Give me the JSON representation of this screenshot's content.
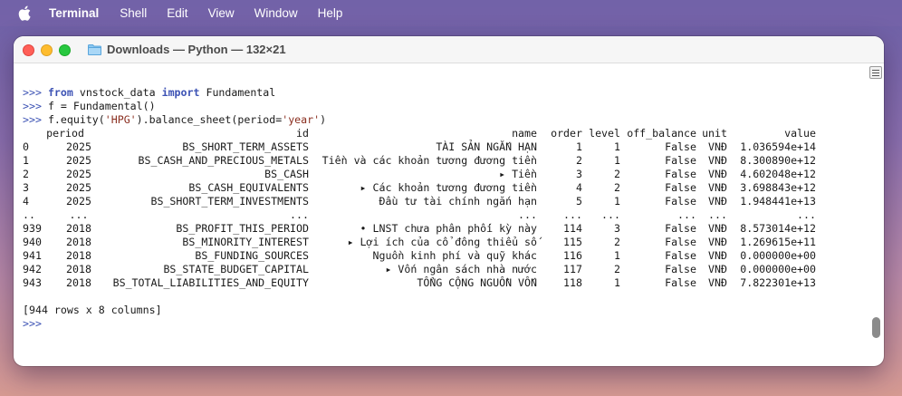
{
  "menubar": {
    "app_name": "Terminal",
    "items": [
      "Shell",
      "Edit",
      "View",
      "Window",
      "Help"
    ]
  },
  "window": {
    "title": "Downloads — Python — 132×21"
  },
  "terminal": {
    "prompt": ">>>",
    "line1": {
      "kw_from": "from",
      "module": " vnstock_data ",
      "kw_import": "import",
      "name": " Fundamental"
    },
    "line2": "f = Fundamental()",
    "line3": {
      "pre": "f.equity(",
      "arg1": "'HPG'",
      "mid": ").balance_sheet(period=",
      "arg2": "'year'",
      "post": ")"
    },
    "columns": [
      "period",
      "id",
      "name",
      "order",
      "level",
      "off_balance",
      "unit",
      "value"
    ],
    "rows": [
      [
        "0",
        "2025",
        "BS_SHORT_TERM_ASSETS",
        "TÀI SẢN NGẮN HẠN",
        "1",
        "1",
        "False",
        "VNĐ",
        "1.036594e+14"
      ],
      [
        "1",
        "2025",
        "BS_CASH_AND_PRECIOUS_METALS",
        "Tiền và các khoản tương đương tiền",
        "2",
        "1",
        "False",
        "VNĐ",
        "8.300890e+12"
      ],
      [
        "2",
        "2025",
        "BS_CASH",
        "▸ Tiền",
        "3",
        "2",
        "False",
        "VNĐ",
        "4.602048e+12"
      ],
      [
        "3",
        "2025",
        "BS_CASH_EQUIVALENTS",
        "▸ Các khoản tương đương tiền",
        "4",
        "2",
        "False",
        "VNĐ",
        "3.698843e+12"
      ],
      [
        "4",
        "2025",
        "BS_SHORT_TERM_INVESTMENTS",
        "Đầu tư tài chính ngắn hạn",
        "5",
        "1",
        "False",
        "VNĐ",
        "1.948441e+13"
      ],
      [
        "..",
        "...",
        "...",
        "...",
        "...",
        "...",
        "...",
        "...",
        "..."
      ],
      [
        "939",
        "2018",
        "BS_PROFIT_THIS_PERIOD",
        "• LNST chưa phân phối kỳ này",
        "114",
        "3",
        "False",
        "VNĐ",
        "8.573014e+12"
      ],
      [
        "940",
        "2018",
        "BS_MINORITY_INTEREST",
        "▸ Lợi ích của cổ đông thiểu số",
        "115",
        "2",
        "False",
        "VNĐ",
        "1.269615e+11"
      ],
      [
        "941",
        "2018",
        "BS_FUNDING_SOURCES",
        "Nguồn kinh phí và quỹ khác",
        "116",
        "1",
        "False",
        "VNĐ",
        "0.000000e+00"
      ],
      [
        "942",
        "2018",
        "BS_STATE_BUDGET_CAPITAL",
        "▸ Vốn ngân sách nhà nước",
        "117",
        "2",
        "False",
        "VNĐ",
        "0.000000e+00"
      ],
      [
        "943",
        "2018",
        "BS_TOTAL_LIABILITIES_AND_EQUITY",
        "TỔNG CỘNG NGUỒN VỐN",
        "118",
        "1",
        "False",
        "VNĐ",
        "7.822301e+13"
      ]
    ],
    "summary": "[944 rows x 8 columns]"
  }
}
